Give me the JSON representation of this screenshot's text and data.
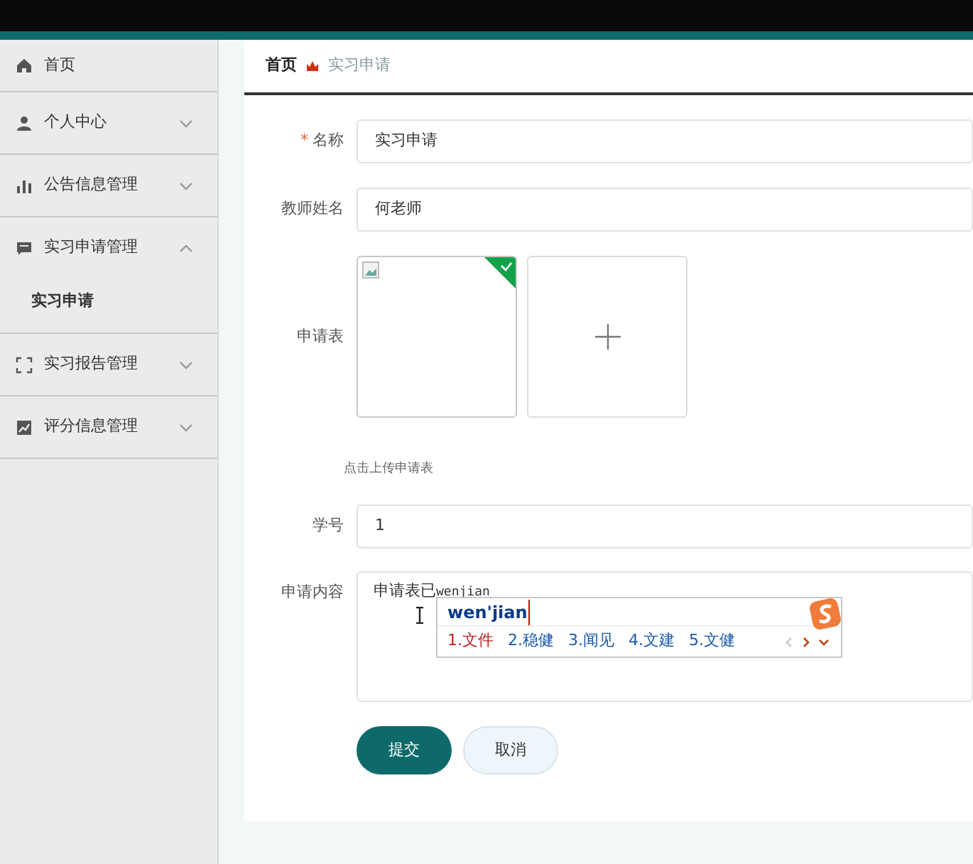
{
  "sidebar": {
    "items": [
      {
        "label": "首页"
      },
      {
        "label": "个人中心",
        "expanded": false
      },
      {
        "label": "公告信息管理",
        "expanded": false
      },
      {
        "label": "实习申请管理",
        "expanded": true,
        "children": [
          {
            "label": "实习申请"
          }
        ]
      },
      {
        "label": "实习报告管理",
        "expanded": false
      },
      {
        "label": "评分信息管理",
        "expanded": false
      }
    ]
  },
  "breadcrumb": [
    "首页",
    "实习申请"
  ],
  "form": {
    "name": {
      "label": "名称",
      "required_mark": "*",
      "value": "实习申请"
    },
    "teacher": {
      "label": "教师姓名",
      "value": "何老师"
    },
    "upload": {
      "label": "申请表",
      "files": [
        {
          "uploaded": true
        }
      ],
      "hint": "点击上传申请表"
    },
    "student_no": {
      "label": "学号",
      "value": "1"
    },
    "content": {
      "label": "申请内容",
      "value": "申请表已",
      "composing": "wenjian"
    },
    "buttons": [
      "提交",
      "取消"
    ]
  },
  "ime": {
    "input": "wen'jian",
    "candidates": [
      {
        "label": "1.文件",
        "selected": true
      },
      {
        "label": "2.稳健",
        "selected": false
      },
      {
        "label": "3.闻见",
        "selected": false
      },
      {
        "label": "4.文建",
        "selected": false
      },
      {
        "label": "5.文健",
        "selected": false
      }
    ]
  }
}
